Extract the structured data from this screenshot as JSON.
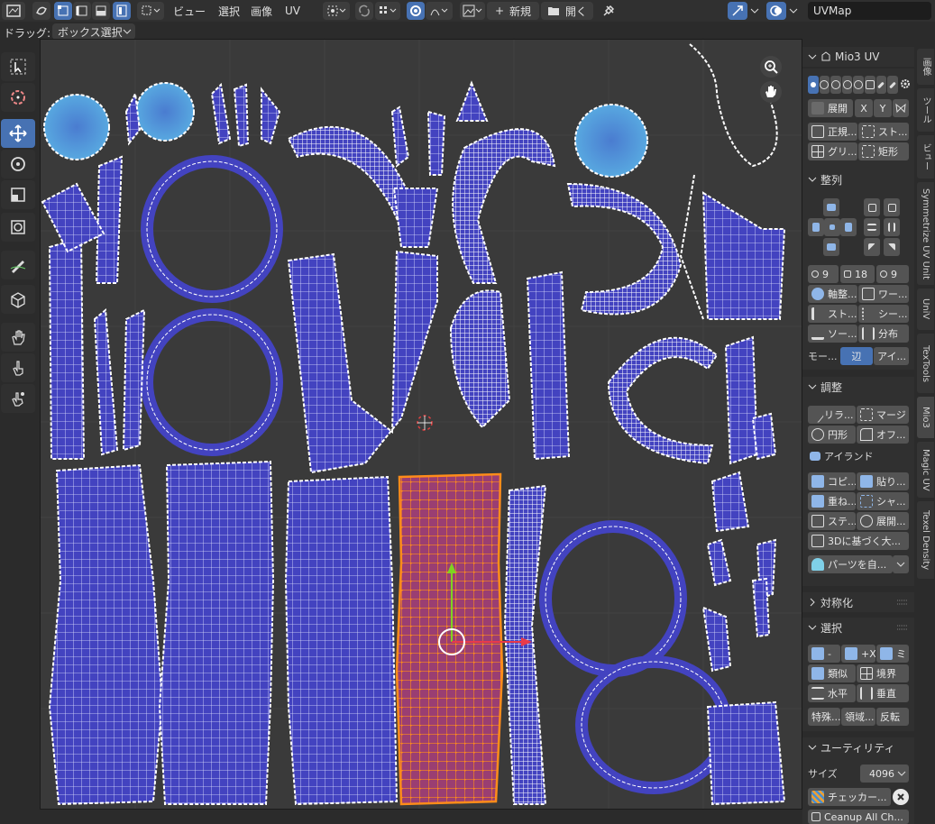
{
  "topbar": {
    "menus": [
      "ビュー",
      "選択",
      "画像",
      "UV"
    ],
    "new_label": "新規",
    "open_label": "開く",
    "uvmap_name": "UVMap"
  },
  "drag": {
    "label": "ドラッグ:",
    "value": "ボックス選択"
  },
  "tools": [
    "select-box-tool",
    "cursor-tool",
    "move-tool",
    "rotate-tool",
    "scale-tool",
    "transform-tool",
    "annotate-tool",
    "mesh-tool",
    "grab-tool",
    "relax-tool",
    "pinch-tool"
  ],
  "panel": {
    "mio3_title": "Mio3 UV",
    "unwrap": {
      "label": "展開",
      "x": "X",
      "y": "Y"
    },
    "row2": [
      "正規...",
      "スト..."
    ],
    "row3": [
      "グリ...",
      "矩形"
    ],
    "align_title": "整列",
    "num_row": [
      "9",
      "18",
      "9"
    ],
    "align_rows": [
      [
        "軸整...",
        "ワー..."
      ],
      [
        "スト...",
        "シー..."
      ],
      [
        "ソー...",
        "分布"
      ]
    ],
    "mode": {
      "label": "モー...",
      "opt1": "辺",
      "opt2": "アイ..."
    },
    "adjust_title": "調整",
    "adjust_rows": [
      [
        "リラ...",
        "マージ"
      ],
      [
        "円形",
        "オフ..."
      ]
    ],
    "island": "アイランド",
    "island_rows": [
      [
        "コピ...",
        "貼り..."
      ],
      [
        "重ね...",
        "シャ..."
      ],
      [
        "ステ...",
        "展開..."
      ]
    ],
    "based_3d": "3Dに基づく大...",
    "parts": "パーツを自...",
    "sym_title": "対称化",
    "select_title": "選択",
    "select_rows": [
      [
        "-",
        "+X",
        "ミ"
      ],
      [
        "類似",
        "境界"
      ],
      [
        "水平",
        "垂直"
      ],
      [
        "特殊...",
        "領域...",
        "反転"
      ]
    ],
    "util_title": "ユーティリティ",
    "size_label": "サイズ",
    "size_value": "4096",
    "checker": "チェッカー...",
    "cleanup": "Ceanup All Ch..."
  },
  "vtabs": [
    "画像",
    "ツール",
    "ビュー",
    "Symmetrize UV Unit",
    "UniV",
    "TexTools",
    "Mio3",
    "Magic UV",
    "Texel Density"
  ],
  "colors": {
    "accent": "#4772b3",
    "island_fill": "#4343c0",
    "island_light": "#4a8fd0",
    "selected": "#ff8c1a",
    "selected_fill": "#9a3e72",
    "canvas_bg": "#3a3a3a"
  }
}
